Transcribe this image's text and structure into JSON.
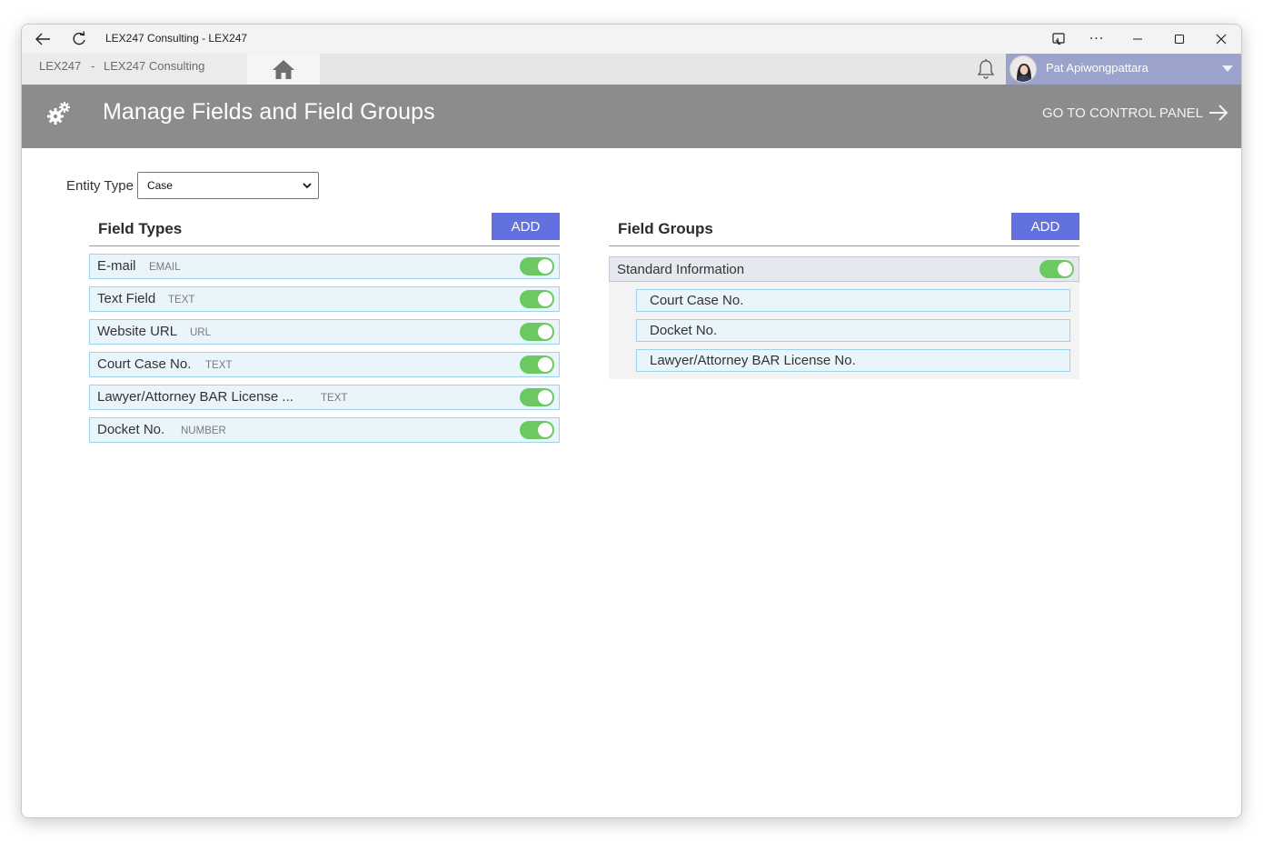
{
  "window": {
    "title": "LEX247 Consulting - LEX247"
  },
  "nav": {
    "org_short": "LEX247",
    "separator": "-",
    "org_name": "LEX247 Consulting",
    "user_name": "Pat Apiwongpattara"
  },
  "header": {
    "title": "Manage Fields and Field Groups",
    "control_panel_link": "GO TO CONTROL PANEL"
  },
  "entity_type": {
    "label": "Entity Type",
    "selected": "Case"
  },
  "field_types": {
    "title": "Field Types",
    "add_label": "ADD",
    "items": [
      {
        "name": "E-mail",
        "type": "EMAIL",
        "enabled": true
      },
      {
        "name": "Text Field",
        "type": "TEXT",
        "enabled": true
      },
      {
        "name": "Website URL",
        "type": "URL",
        "enabled": true
      },
      {
        "name": "Court Case No.",
        "type": "TEXT",
        "enabled": true
      },
      {
        "name": "Lawyer/Attorney BAR License ...",
        "type": "TEXT",
        "enabled": true
      },
      {
        "name": "Docket No.",
        "type": "NUMBER",
        "enabled": true
      }
    ]
  },
  "field_groups": {
    "title": "Field Groups",
    "add_label": "ADD",
    "groups": [
      {
        "name": "Standard Information",
        "enabled": true,
        "fields": [
          "Court Case No.",
          "Docket No.",
          "Lawyer/Attorney BAR License No."
        ]
      }
    ]
  },
  "colors": {
    "header_bg": "#8c8c8c",
    "add_button": "#6370df",
    "toggle_on": "#6cc860",
    "row_bg": "#e9f5fb",
    "row_border": "#9ed2ea",
    "user_bg": "#9ba3cd"
  }
}
